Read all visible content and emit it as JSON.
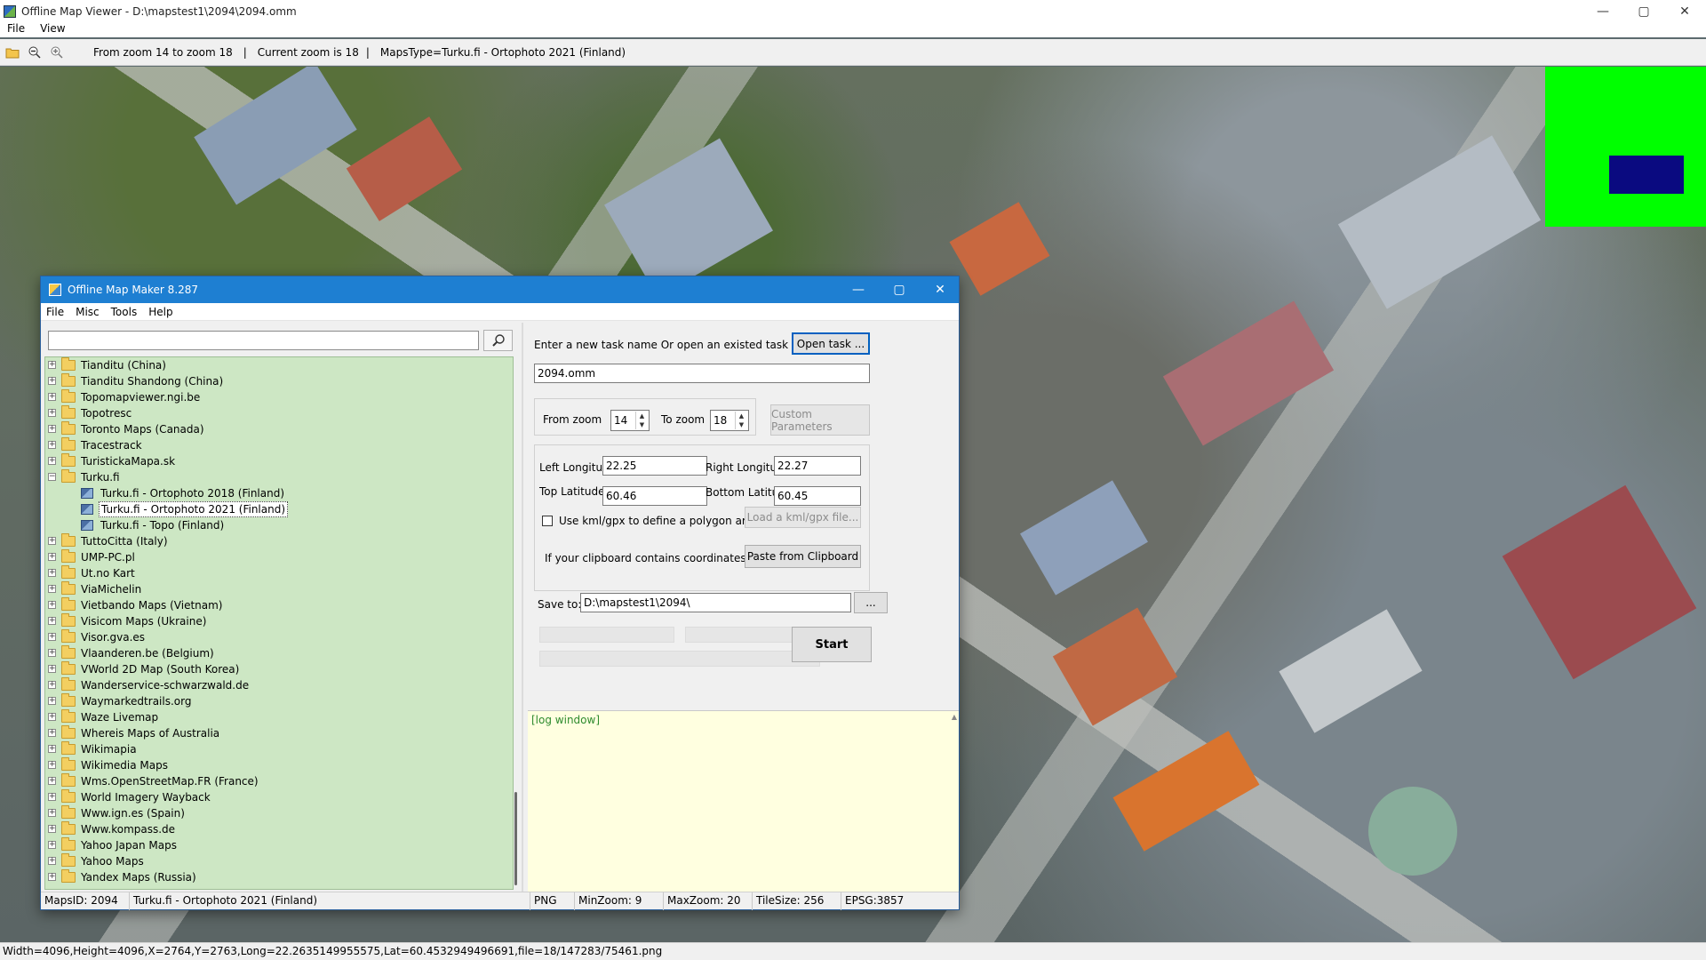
{
  "window": {
    "title": "Offline Map Viewer - D:\\mapstest1\\2094\\2094.omm",
    "menu": [
      "File",
      "View"
    ],
    "controls": {
      "minimize": "—",
      "maximize": "▢",
      "close": "✕"
    }
  },
  "toolbar": {
    "zoom_range": "From zoom 14 to zoom 18",
    "sep1": "|",
    "current_zoom": "Current zoom is 18",
    "sep2": "|",
    "maps_type": "MapsType=Turku.fi - Ortophoto 2021 (Finland)",
    "icons": [
      "open-folder-icon",
      "zoom-out-icon",
      "zoom-in-icon"
    ]
  },
  "status": {
    "text": "Width=4096,Height=4096,X=2764,Y=2763,Long=22.2635149955575,Lat=60.4532949496691,file=18/147283/75461.png"
  },
  "colors": {
    "minimap_bg": "#00ff00",
    "minimap_view": "#0a0a80",
    "tree_bg": "#cde7c4",
    "log_bg": "#ffffe0",
    "dialog_title_bg": "#1e7fd2"
  },
  "dialog": {
    "title": "Offline Map Maker 8.287",
    "menu": [
      "File",
      "Misc",
      "Tools",
      "Help"
    ],
    "search": {
      "value": "",
      "placeholder": ""
    },
    "tree": [
      {
        "label": "Tianditu (China)",
        "type": "folder",
        "expanded": false
      },
      {
        "label": "Tianditu Shandong (China)",
        "type": "folder",
        "expanded": false
      },
      {
        "label": "Topomapviewer.ngi.be",
        "type": "folder",
        "expanded": false
      },
      {
        "label": "Topotresc",
        "type": "folder",
        "expanded": false
      },
      {
        "label": "Toronto Maps (Canada)",
        "type": "folder",
        "expanded": false
      },
      {
        "label": "Tracestrack",
        "type": "folder",
        "expanded": false
      },
      {
        "label": "TuristickaMapa.sk",
        "type": "folder",
        "expanded": false
      },
      {
        "label": "Turku.fi",
        "type": "folder",
        "expanded": true
      },
      {
        "label": "Turku.fi - Ortophoto 2018 (Finland)",
        "type": "leaf",
        "selected": false
      },
      {
        "label": "Turku.fi - Ortophoto 2021 (Finland)",
        "type": "leaf",
        "selected": true
      },
      {
        "label": "Turku.fi - Topo (Finland)",
        "type": "leaf",
        "selected": false
      },
      {
        "label": "TuttoCitta (Italy)",
        "type": "folder",
        "expanded": false
      },
      {
        "label": "UMP-PC.pl",
        "type": "folder",
        "expanded": false
      },
      {
        "label": "Ut.no Kart",
        "type": "folder",
        "expanded": false
      },
      {
        "label": "ViaMichelin",
        "type": "folder",
        "expanded": false
      },
      {
        "label": "Vietbando Maps (Vietnam)",
        "type": "folder",
        "expanded": false
      },
      {
        "label": "Visicom Maps (Ukraine)",
        "type": "folder",
        "expanded": false
      },
      {
        "label": "Visor.gva.es",
        "type": "folder",
        "expanded": false
      },
      {
        "label": "Vlaanderen.be (Belgium)",
        "type": "folder",
        "expanded": false
      },
      {
        "label": "VWorld 2D Map (South Korea)",
        "type": "folder",
        "expanded": false
      },
      {
        "label": "Wanderservice-schwarzwald.de",
        "type": "folder",
        "expanded": false
      },
      {
        "label": "Waymarkedtrails.org",
        "type": "folder",
        "expanded": false
      },
      {
        "label": "Waze Livemap",
        "type": "folder",
        "expanded": false
      },
      {
        "label": "Whereis Maps of Australia",
        "type": "folder",
        "expanded": false
      },
      {
        "label": "Wikimapia",
        "type": "folder",
        "expanded": false
      },
      {
        "label": "Wikimedia Maps",
        "type": "folder",
        "expanded": false
      },
      {
        "label": "Wms.OpenStreetMap.FR (France)",
        "type": "folder",
        "expanded": false
      },
      {
        "label": "World Imagery Wayback",
        "type": "folder",
        "expanded": false
      },
      {
        "label": "Www.ign.es (Spain)",
        "type": "folder",
        "expanded": false
      },
      {
        "label": "Www.kompass.de",
        "type": "folder",
        "expanded": false
      },
      {
        "label": "Yahoo Japan Maps",
        "type": "folder",
        "expanded": false
      },
      {
        "label": "Yahoo Maps",
        "type": "folder",
        "expanded": false
      },
      {
        "label": "Yandex Maps (Russia)",
        "type": "folder",
        "expanded": false
      }
    ],
    "task": {
      "prompt": "Enter a new task name Or open an existed task to continue:",
      "open_button": "Open task ...",
      "name_value": "2094.omm"
    },
    "zoom": {
      "from_label": "From zoom",
      "from_value": "14",
      "to_label": "To zoom",
      "to_value": "18",
      "custom_button": "Custom Parameters"
    },
    "bounds": {
      "left_label": "Left Longitude",
      "left_value": "22.25",
      "right_label": "Right Longitude",
      "right_value": "22.27",
      "top_label": "Top Latitude",
      "top_value": "60.46",
      "bottom_label": "Bottom Latitude",
      "bottom_value": "60.45",
      "kml_label": "Use kml/gpx to define a polygon area",
      "kml_checked": false,
      "kml_button": "Load a kml/gpx file...",
      "clipboard_label": "If your clipboard contains coordinates values:",
      "clipboard_button": "Paste from Clipboard"
    },
    "save": {
      "label": "Save to:",
      "path": "D:\\mapstest1\\2094\\",
      "browse_button": "...",
      "start_button": "Start"
    },
    "log": {
      "text": "[log window]"
    },
    "status": {
      "maps_id": "MapsID: 2094",
      "map_name": "Turku.fi - Ortophoto 2021 (Finland)",
      "format": "PNG",
      "min_zoom": "MinZoom: 9",
      "max_zoom": "MaxZoom: 20",
      "tile_size": "TileSize: 256",
      "epsg": "EPSG:3857"
    }
  }
}
